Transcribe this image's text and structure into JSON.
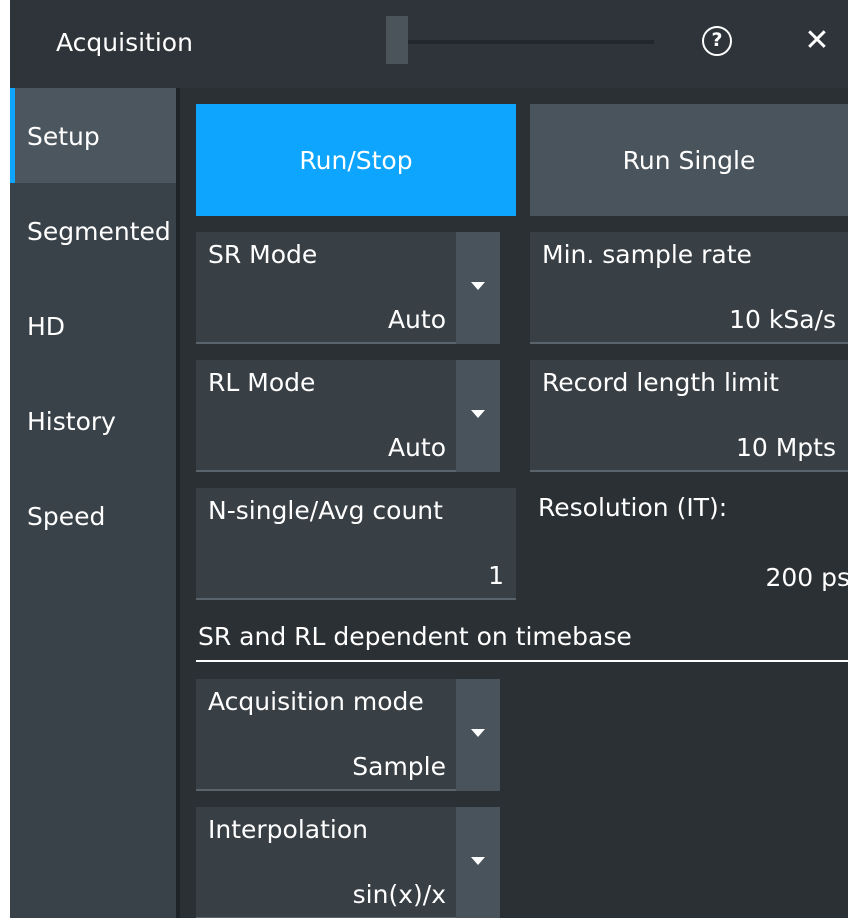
{
  "window": {
    "title": "Acquisition",
    "help_glyph": "?",
    "close_glyph": "✕"
  },
  "sidebar": {
    "items": [
      {
        "label": "Setup",
        "active": true
      },
      {
        "label": "Segmented",
        "active": false
      },
      {
        "label": "HD",
        "active": false
      },
      {
        "label": "History",
        "active": false
      },
      {
        "label": "Speed",
        "active": false
      }
    ]
  },
  "buttons": {
    "run_stop": "Run/Stop",
    "run_single": "Run Single"
  },
  "fields": {
    "sr_mode": {
      "label": "SR Mode",
      "value": "Auto"
    },
    "min_sample_rate": {
      "label": "Min. sample rate",
      "value": "10 kSa/s"
    },
    "rl_mode": {
      "label": "RL Mode",
      "value": "Auto"
    },
    "record_length_limit": {
      "label": "Record length limit",
      "value": "10 Mpts"
    },
    "n_single_avg_count": {
      "label": "N-single/Avg count",
      "value": "1"
    },
    "resolution": {
      "label": "Resolution (IT):",
      "value": "200 ps"
    },
    "acquisition_mode": {
      "label": "Acquisition mode",
      "value": "Sample"
    },
    "interpolation": {
      "label": "Interpolation",
      "value": "sin(x)/x"
    }
  },
  "section_label": "SR and RL dependent on timebase",
  "colors": {
    "accent": "#0ea5ff",
    "background": "#2b3034",
    "sidebar": "#3a4249",
    "field": "#383f45"
  }
}
